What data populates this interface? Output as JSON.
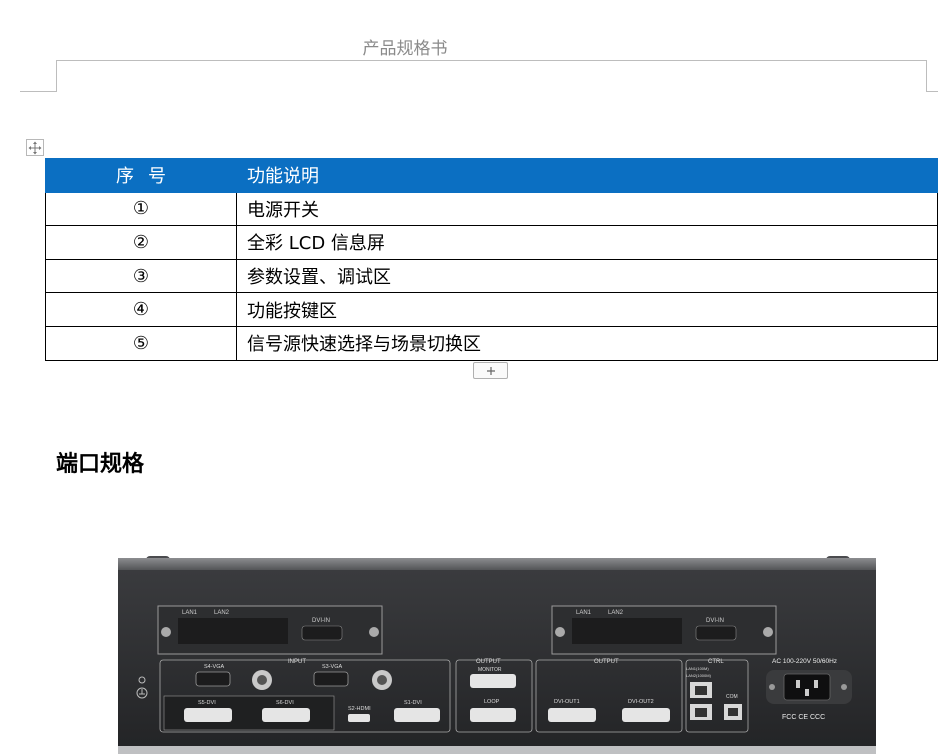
{
  "header": {
    "title": "产品规格书"
  },
  "table": {
    "headers": [
      "序号",
      "功能说明"
    ],
    "rows": [
      {
        "index": "①",
        "desc": "电源开关"
      },
      {
        "index": "②",
        "desc": "全彩 LCD 信息屏"
      },
      {
        "index": "③",
        "desc": "参数设置、调试区"
      },
      {
        "index": "④",
        "desc": "功能按键区"
      },
      {
        "index": "⑤",
        "desc": "信号源快速选择与场景切换区"
      }
    ]
  },
  "section": {
    "heading": "端口规格"
  },
  "device": {
    "card_labels": {
      "lan1": "LAN1",
      "lan2": "LAN2",
      "dvi_in": "DVI-IN"
    },
    "input_group": "INPUT",
    "s4_vga": "S4-VGA",
    "s3_vga": "S3-VGA",
    "s5_dvi": "S5-DVI",
    "s6_dvi": "S6-DVI",
    "s2_hdmi": "S2-HDMI",
    "s1_dvi": "S1-DVI",
    "output_monitor_group": "OUTPUT",
    "monitor": "MONITOR",
    "loop": "LOOP",
    "output_group": "OUTPUT",
    "dvi_out1": "DVI-OUT1",
    "dvi_out2": "DVI-OUT2",
    "ctrl_group": "CTRL",
    "lan1_speed": "LAN1(100M)",
    "lan2_speed": "LAN2(1000M)",
    "com": "COM",
    "power_rating": "AC 100-220V 50/60Hz",
    "certs": "FCC CE CCC"
  },
  "colors": {
    "table_header_bg": "#0b6fc2",
    "chassis": "#2a2b2d"
  }
}
